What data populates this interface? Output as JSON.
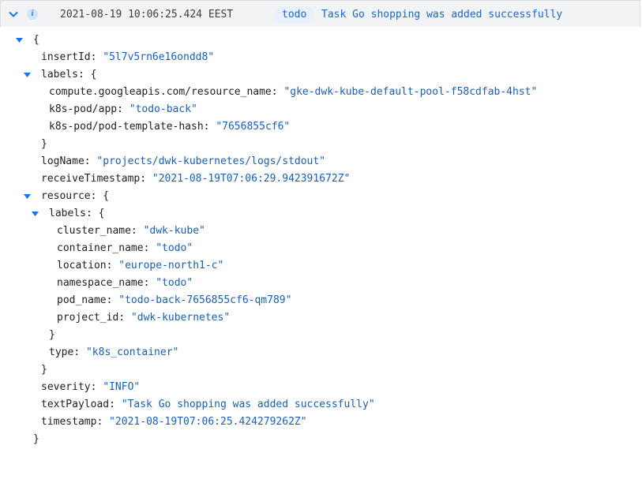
{
  "header": {
    "timestamp": "2021-08-19 10:06:25.424 EEST",
    "severity_icon": "info-icon",
    "chip": "todo",
    "summary": "Task Go shopping was added successfully"
  },
  "tree": {
    "open_brace": "{",
    "insertId_key": "insertId",
    "insertId_value": "\"5l7v5rn6e16ondd8\"",
    "labels_key": "labels",
    "labels_open": "{",
    "resource_name_key": "compute.googleapis.com/resource_name",
    "resource_name_value": "\"gke-dwk-kube-default-pool-f58cdfab-4hst\"",
    "app_key": "k8s-pod/app",
    "app_value": "\"todo-back\"",
    "pth_key": "k8s-pod/pod-template-hash",
    "pth_value": "\"7656855cf6\"",
    "labels_close": "}",
    "logName_key": "logName",
    "logName_value": "\"projects/dwk-kubernetes/logs/stdout\"",
    "rts_key": "receiveTimestamp",
    "rts_value": "\"2021-08-19T07:06:29.942391672Z\"",
    "resource_key": "resource",
    "resource_open": "{",
    "res_labels_key": "labels",
    "res_labels_open": "{",
    "cluster_key": "cluster_name",
    "cluster_value": "\"dwk-kube\"",
    "container_key": "container_name",
    "container_value": "\"todo\"",
    "location_key": "location",
    "location_value": "\"europe-north1-c\"",
    "namespace_key": "namespace_name",
    "namespace_value": "\"todo\"",
    "pod_key": "pod_name",
    "pod_value": "\"todo-back-7656855cf6-qm789\"",
    "project_key": "project_id",
    "project_value": "\"dwk-kubernetes\"",
    "res_labels_close": "}",
    "type_key": "type",
    "type_value": "\"k8s_container\"",
    "resource_close": "}",
    "severity_key": "severity",
    "severity_value": "\"INFO\"",
    "textPayload_key": "textPayload",
    "textPayload_value": "\"Task Go shopping was added successfully\"",
    "timestamp_key": "timestamp",
    "timestamp_value": "\"2021-08-19T07:06:25.424279262Z\"",
    "close_brace": "}"
  }
}
